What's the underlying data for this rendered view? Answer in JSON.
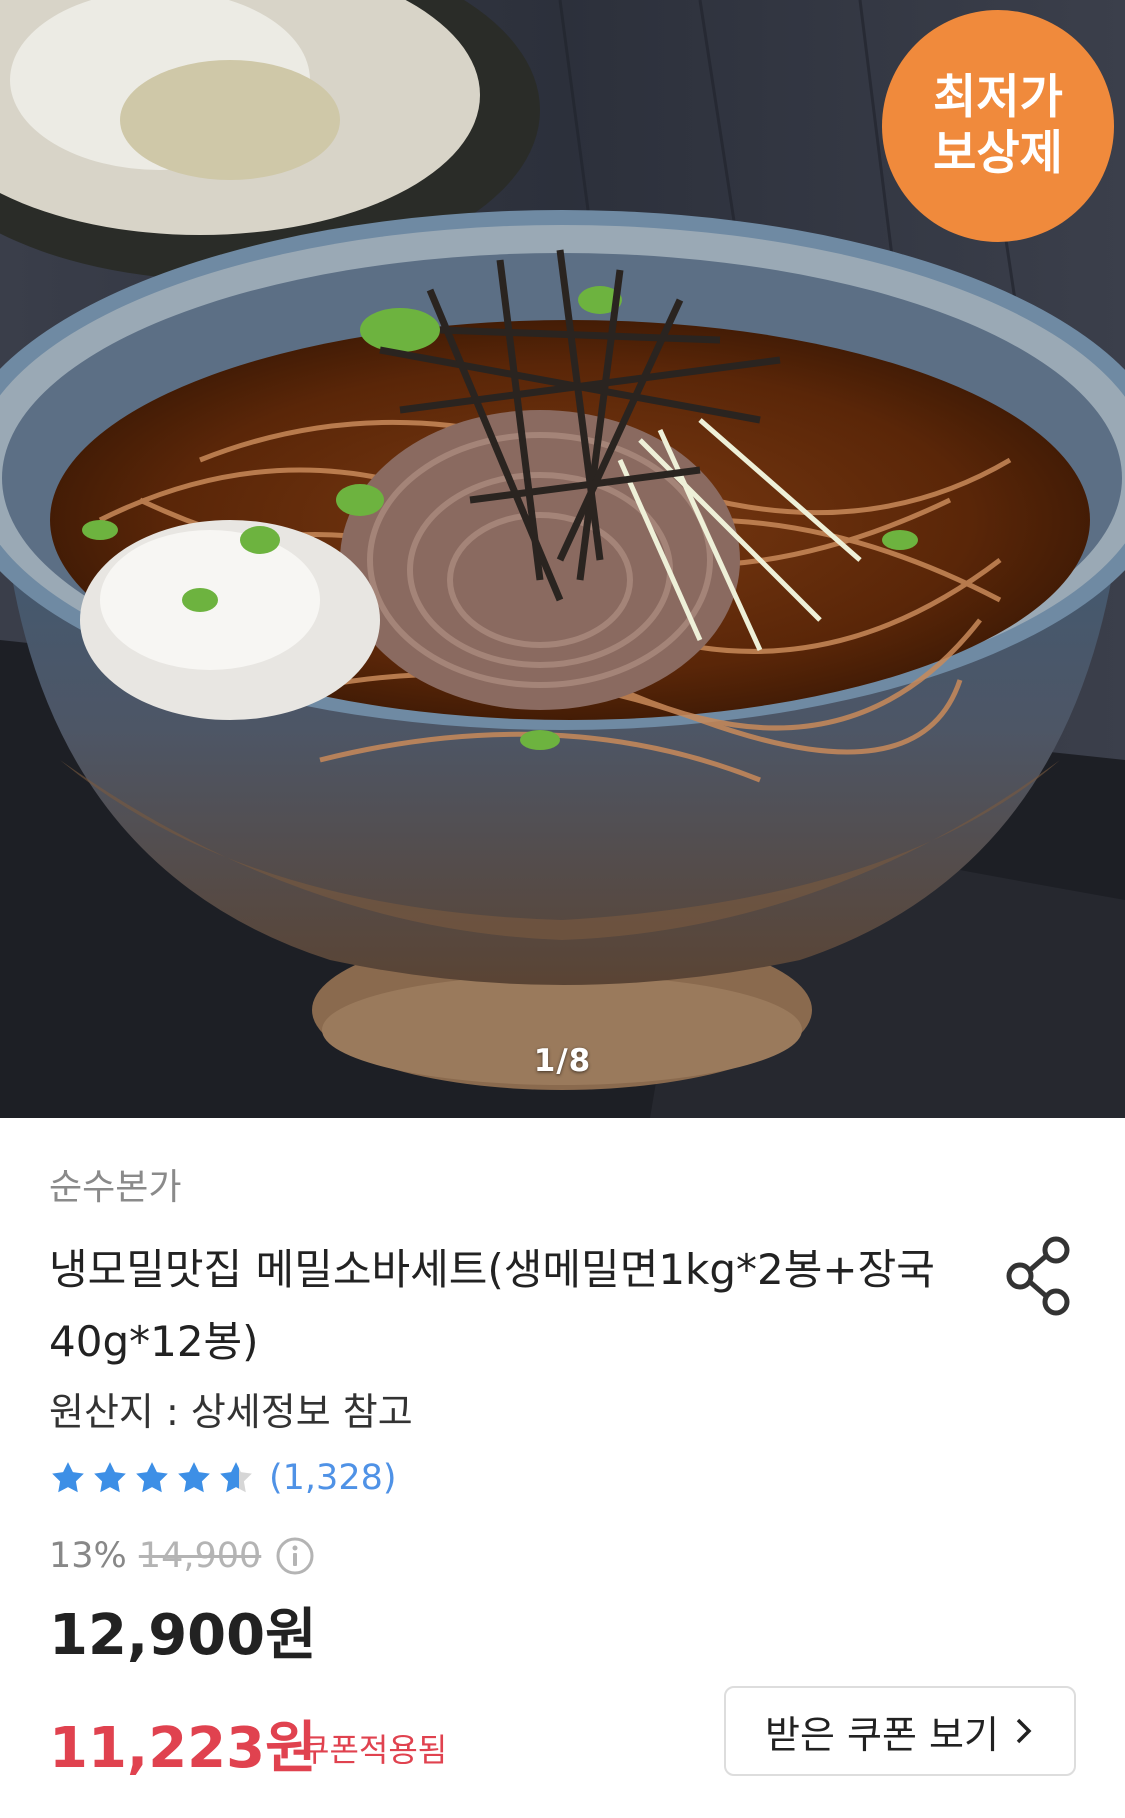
{
  "hero": {
    "counter": "1/8",
    "badge_line1": "최저가",
    "badge_line2": "보상제",
    "image_alt": "soba-noodle-bowl-photo"
  },
  "product": {
    "brand": "순수본가",
    "title": "냉모밀맛집 메밀소바세트(생메밀면1kg*2봉+장국40g*12봉)",
    "origin": "원산지 : 상세정보 참고",
    "rating_value": 4.5,
    "review_count": "(1,328)",
    "discount_rate": "13%",
    "original_price": "14,900",
    "price": "12,900원",
    "coupon_price": "11,223원",
    "coupon_applied_label": "쿠폰적용됨",
    "coupon_button_label": "받은 쿠폰 보기"
  },
  "colors": {
    "star": "#3d8fe6",
    "coupon_red": "#e0424f",
    "badge_orange": "#f08a3c",
    "review_blue": "#4f92e6"
  },
  "icons": {
    "share": "share-icon",
    "info": "info-icon",
    "chevron": "chevron-right-icon",
    "star": "star-icon"
  }
}
